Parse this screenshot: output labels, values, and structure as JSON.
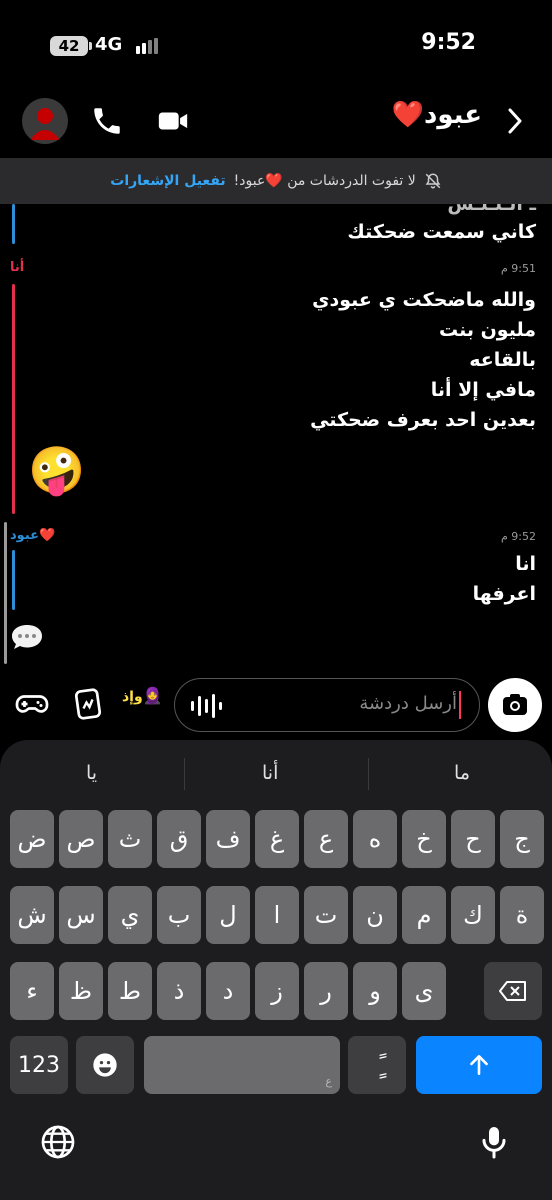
{
  "status_bar": {
    "time": "9:52",
    "battery": "42",
    "network": "4G"
  },
  "header": {
    "title": "عبود❤️"
  },
  "banner": {
    "text": "لا تفوت الدردشات من ❤️عبود!",
    "action": "تفعيل الإشعارات"
  },
  "messages": {
    "prev_line1": "ـ الـلـلـس",
    "prev_line2": "كاني سمعت ضحكتك",
    "me": {
      "sender": "أنا",
      "time": "9:51 م",
      "lines": [
        "والله ماضحكت ي عبودي",
        "مليون بنت",
        "بالقاعه",
        "مافي إلا أنا",
        "بعدين احد بعرف ضحكتي"
      ],
      "emoji": "🤪"
    },
    "them": {
      "sender": "عبود❤️",
      "time": "9:52 م",
      "lines": [
        "انا",
        "اعرفها"
      ]
    }
  },
  "composer": {
    "placeholder": "أرسل دردشة",
    "bitmoji_label": "وإذ"
  },
  "keyboard": {
    "suggestions": [
      "ما",
      "أنا",
      "يا"
    ],
    "row1": [
      "ج",
      "ح",
      "خ",
      "ه",
      "ع",
      "غ",
      "ف",
      "ق",
      "ث",
      "ص",
      "ض"
    ],
    "row2": [
      "ة",
      "ك",
      "م",
      "ن",
      "ت",
      "ا",
      "ل",
      "ب",
      "ي",
      "س",
      "ش"
    ],
    "row3": [
      "ى",
      "و",
      "ر",
      "ز",
      "د",
      "ذ",
      "ط",
      "ظ",
      "ء"
    ],
    "numbers_label": "123",
    "space_hint": "ع",
    "diacritic_label": "ًٍ"
  },
  "colors": {
    "accent_blue": "#35a5f5",
    "me_bar": "#e2314a",
    "them_bar": "#2e8fd8",
    "return_key": "#0a84ff"
  },
  "icons": [
    "avatar-icon",
    "phone-icon",
    "video-icon",
    "back-chevron-icon",
    "bell-off-icon",
    "games-icon",
    "stickers-icon",
    "camera-icon",
    "voice-wave-icon",
    "emoji-key-icon",
    "backspace-icon",
    "return-arrow-icon",
    "globe-icon",
    "microphone-icon"
  ]
}
